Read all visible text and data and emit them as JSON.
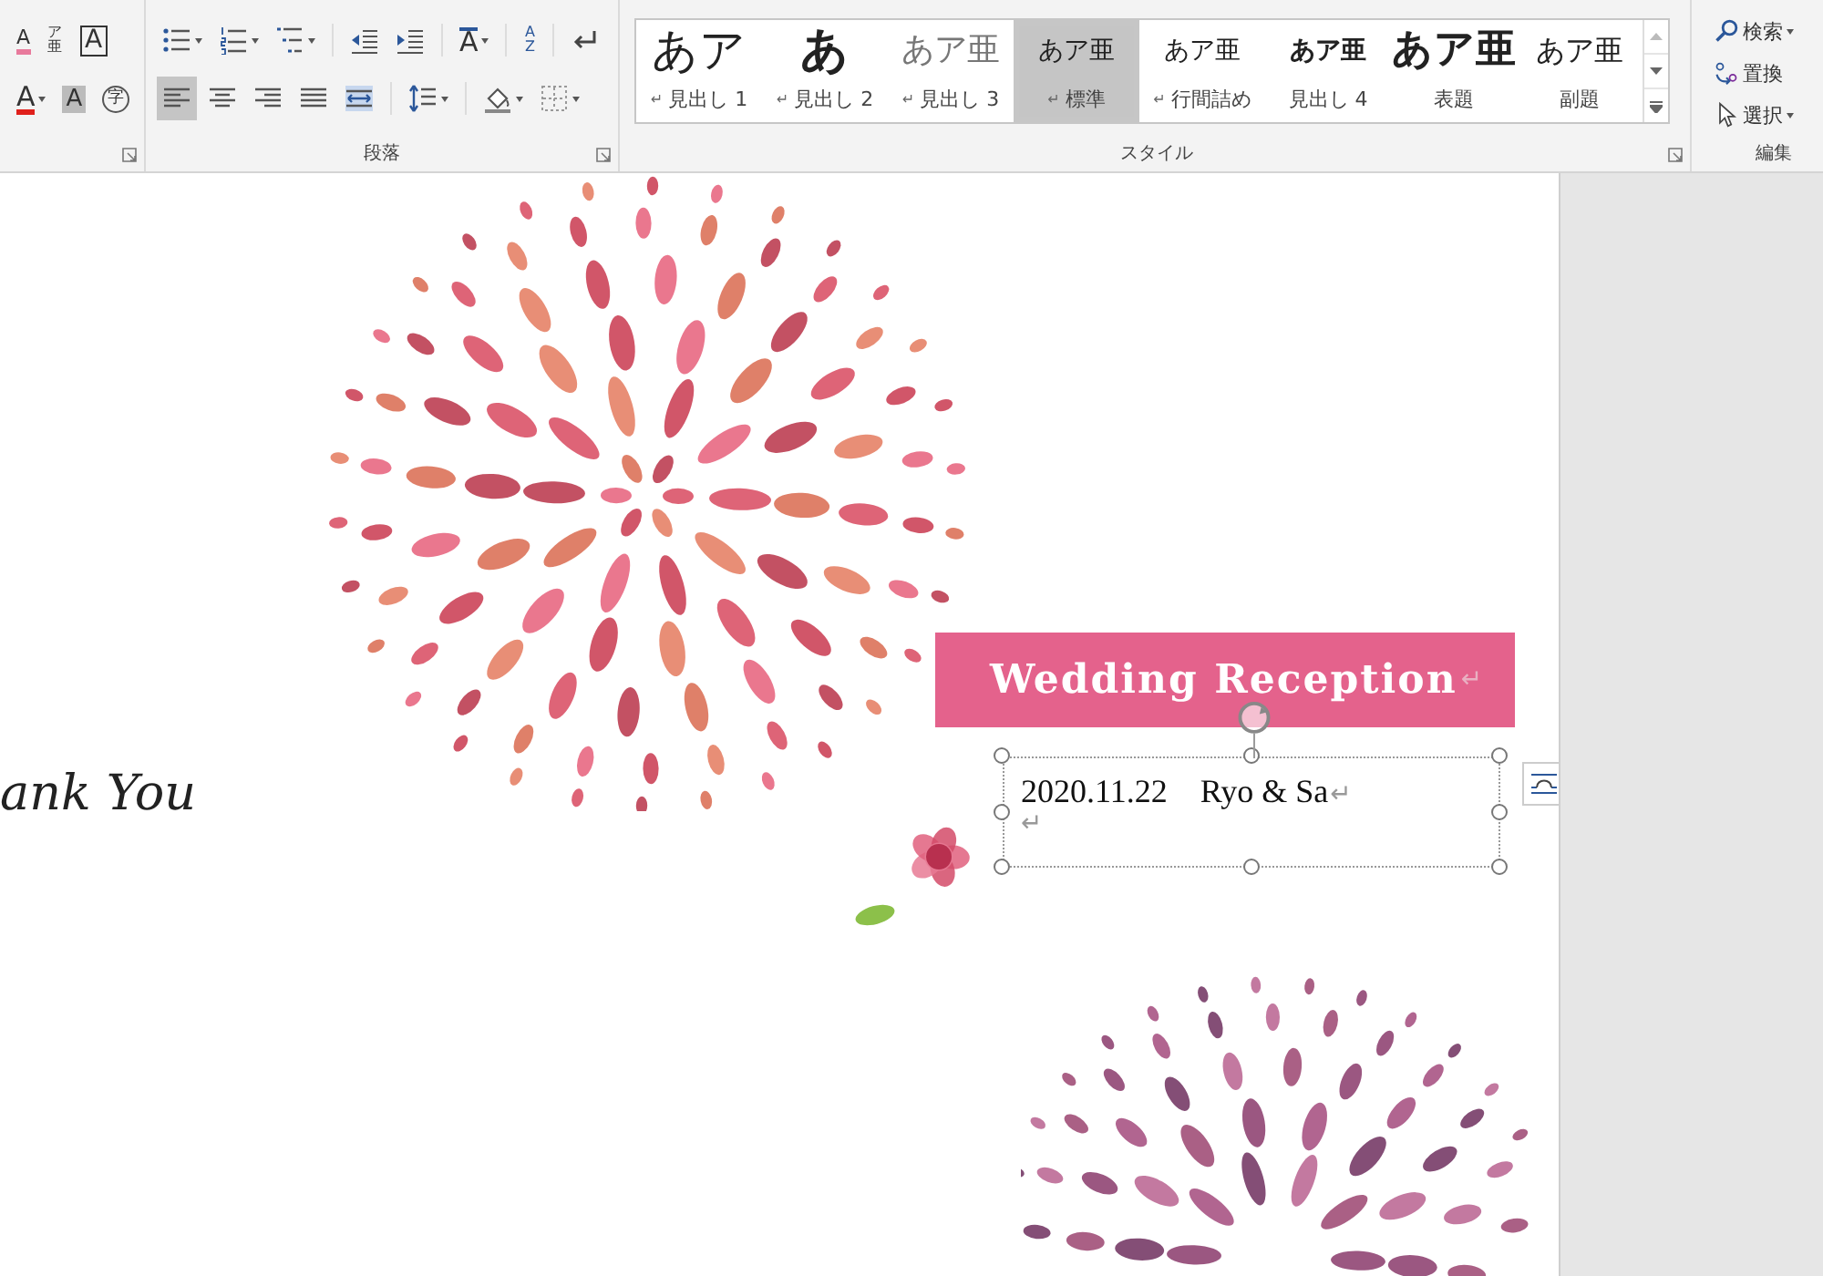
{
  "ribbon": {
    "groups": [
      {
        "kind": "font",
        "launcher": true,
        "rows": [
          [
            {
              "kind": "clear-format",
              "glyph": "A",
              "dropdown": false,
              "selected": false
            },
            {
              "kind": "phonetic-guide",
              "glyph": "ア亜",
              "dropdown": false,
              "selected": false
            },
            {
              "kind": "character-border",
              "glyph": "A",
              "dropdown": false,
              "selected": false
            }
          ],
          [
            {
              "kind": "font-color",
              "glyph": "A",
              "dropdown": true,
              "selected": false
            },
            {
              "kind": "character-shading",
              "glyph": "A",
              "dropdown": false,
              "selected": false
            },
            {
              "kind": "enclosed-character",
              "glyph": "字",
              "dropdown": false,
              "selected": false
            }
          ]
        ]
      },
      {
        "kind": "paragraph",
        "label": "段落",
        "launcher": true,
        "rows": [
          [
            {
              "kind": "bullets",
              "dropdown": true,
              "selected": false
            },
            {
              "kind": "numbering",
              "dropdown": true,
              "selected": false
            },
            {
              "kind": "multilevel-list",
              "dropdown": true,
              "selected": false
            },
            {
              "kind": "decrease-indent",
              "dropdown": false,
              "selected": false
            },
            {
              "kind": "increase-indent",
              "dropdown": false,
              "selected": false
            },
            {
              "kind": "text-direction",
              "glyph": "A",
              "dropdown": true,
              "selected": false
            },
            {
              "kind": "sort",
              "glyph": "AZ",
              "dropdown": false,
              "selected": false
            },
            {
              "kind": "paragraph-mark",
              "dropdown": false,
              "selected": false
            }
          ],
          [
            {
              "kind": "align-left",
              "dropdown": false,
              "selected": true
            },
            {
              "kind": "align-center",
              "dropdown": false,
              "selected": false
            },
            {
              "kind": "align-right",
              "dropdown": false,
              "selected": false
            },
            {
              "kind": "justify",
              "dropdown": false,
              "selected": false
            },
            {
              "kind": "distribute",
              "dropdown": false,
              "selected": false
            },
            {
              "kind": "line-spacing",
              "dropdown": true,
              "selected": false
            },
            {
              "kind": "shading",
              "dropdown": true,
              "selected": false
            },
            {
              "kind": "borders",
              "dropdown": true,
              "selected": false
            }
          ]
        ]
      }
    ],
    "styles": {
      "label": "スタイル",
      "launcher": true,
      "items": [
        {
          "kind": "heading1",
          "preview": "あア",
          "mark": "↵",
          "name": "見出し 1",
          "selected": false
        },
        {
          "kind": "heading2",
          "preview": "あ",
          "mark": "↵",
          "name": "見出し 2",
          "selected": false
        },
        {
          "kind": "heading3",
          "preview": "あア亜",
          "mark": "↵",
          "name": "見出し 3",
          "selected": false
        },
        {
          "kind": "normal",
          "preview": "あア亜",
          "mark": "↵",
          "name": "標準",
          "selected": true
        },
        {
          "kind": "no-spacing",
          "preview": "あア亜",
          "mark": "↵",
          "name": "行間詰め",
          "selected": false
        },
        {
          "kind": "heading4",
          "preview": "あア亜",
          "name": "見出し 4",
          "selected": false
        },
        {
          "kind": "title",
          "preview": "あア亜",
          "name": "表題",
          "selected": false
        },
        {
          "kind": "subtitle",
          "preview": "あア亜",
          "name": "副題",
          "selected": false
        }
      ]
    },
    "editing": {
      "label": "編集",
      "items": [
        {
          "kind": "find",
          "label": "検索",
          "dropdown": true
        },
        {
          "kind": "replace",
          "label": "置換",
          "dropdown": false
        },
        {
          "kind": "select",
          "label": "選択",
          "dropdown": true
        }
      ]
    }
  },
  "document": {
    "script_text": "ank You",
    "banner": {
      "text": "Wedding Reception",
      "mark": "↵"
    },
    "textbox": {
      "selected": true,
      "lines": [
        {
          "text": "2020.11.22　Ryo & Sa",
          "mark": "↵"
        },
        {
          "mark": "↵"
        }
      ]
    }
  }
}
